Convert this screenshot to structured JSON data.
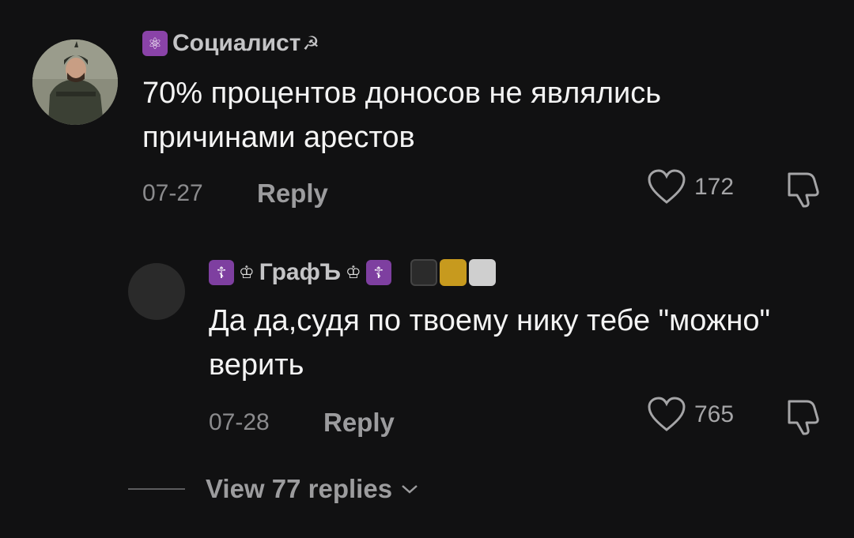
{
  "comments": [
    {
      "username": "Социалист",
      "text": "70% процентов доносов не являлись причинами арестов",
      "date": "07-27",
      "reply_label": "Reply",
      "likes": "172"
    },
    {
      "username": "ГрафЪ",
      "text": "Да да,судя по твоему нику тебе \"можно\" верить",
      "date": "07-28",
      "reply_label": "Reply",
      "likes": "765"
    }
  ],
  "view_replies": "View 77 replies",
  "icons": {
    "atom": "⚛",
    "hammer_sickle": "☭",
    "cross": "☦",
    "crown": "♔"
  },
  "colors": {
    "background": "#111112",
    "badge_purple": "#8a43a8",
    "square_yellow": "#c79a1e"
  }
}
